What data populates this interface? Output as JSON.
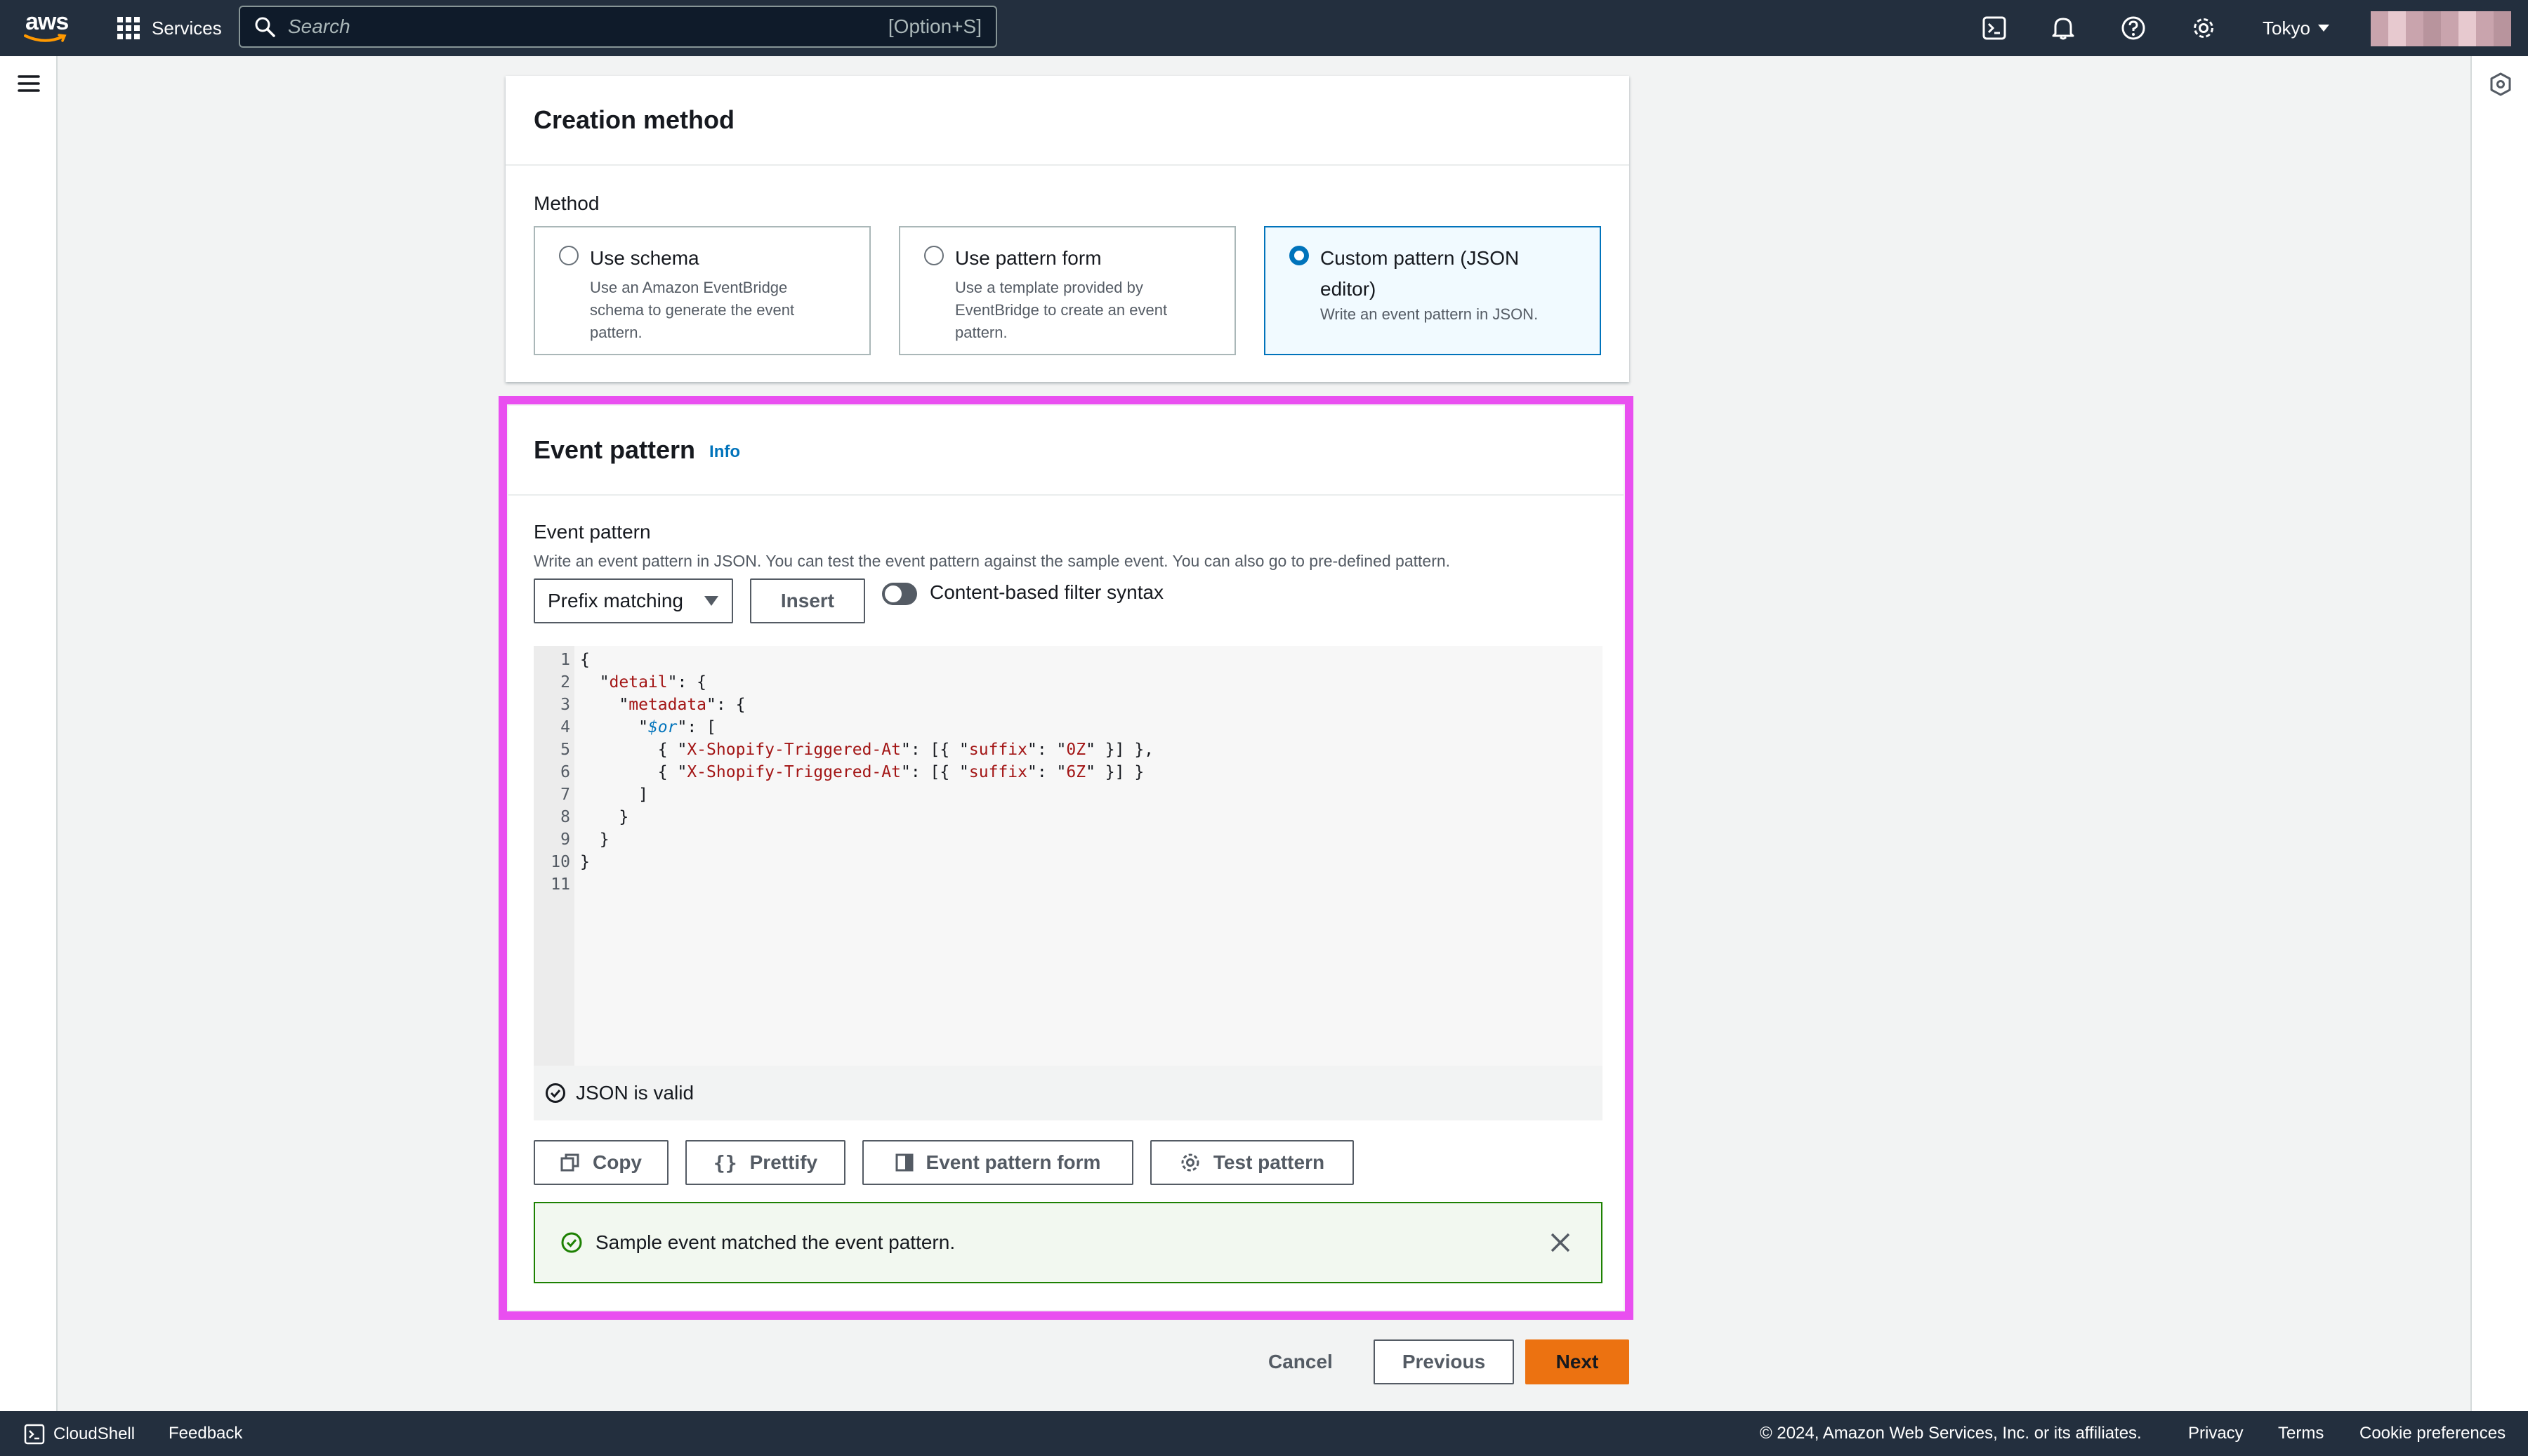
{
  "nav": {
    "logo_text": "aws",
    "services_label": "Services",
    "search_placeholder": "Search",
    "search_shortcut": "[Option+S]",
    "region": "Tokyo"
  },
  "creation_method": {
    "title": "Creation method",
    "method_label": "Method",
    "options": [
      {
        "title": "Use schema",
        "description": "Use an Amazon EventBridge schema to generate the event pattern.",
        "selected": false
      },
      {
        "title": "Use pattern form",
        "description": "Use a template provided by EventBridge to create an event pattern.",
        "selected": false
      },
      {
        "title": "Custom pattern (JSON editor)",
        "description": "Write an event pattern in JSON.",
        "selected": true
      }
    ]
  },
  "event_pattern": {
    "title": "Event pattern",
    "info_link": "Info",
    "field_label": "Event pattern",
    "description": "Write an event pattern in JSON. You can test the event pattern against the sample event. You can also go to pre-defined pattern.",
    "matching_select": "Prefix matching",
    "insert_button": "Insert",
    "toggle_label": "Content-based filter syntax",
    "toggle_on": false,
    "line_numbers": [
      "1",
      "2",
      "3",
      "4",
      "5",
      "6",
      "7",
      "8",
      "9",
      "10",
      "11"
    ],
    "code_lines": [
      "{",
      "  \"detail\": {",
      "    \"metadata\": {",
      "      \"$or\": [",
      "        { \"X-Shopify-Triggered-At\": [{ \"suffix\": \"0Z\" }] },",
      "        { \"X-Shopify-Triggered-At\": [{ \"suffix\": \"6Z\" }] }",
      "      ]",
      "    }",
      "  }",
      "}",
      ""
    ],
    "validation_message": "JSON is valid",
    "copy_button": "Copy",
    "prettify_button": "Prettify",
    "pattern_form_button": "Event pattern form",
    "test_button": "Test pattern",
    "flash_message": "Sample event matched the event pattern."
  },
  "actions": {
    "cancel": "Cancel",
    "previous": "Previous",
    "next": "Next"
  },
  "footer": {
    "cloudshell": "CloudShell",
    "feedback": "Feedback",
    "copyright": "© 2024, Amazon Web Services, Inc. or its affiliates.",
    "privacy": "Privacy",
    "terms": "Terms",
    "cookies": "Cookie preferences"
  },
  "colors": {
    "nav_bg": "#232f3e",
    "primary_button": "#ec7211",
    "highlight_border": "#e94ff0",
    "success": "#1d8102",
    "link": "#0073bb"
  }
}
